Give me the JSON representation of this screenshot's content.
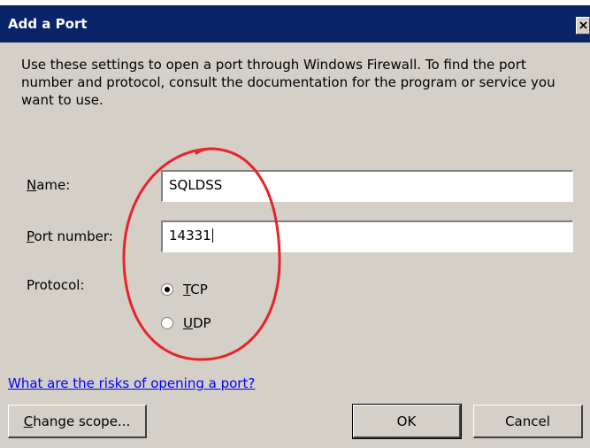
{
  "window": {
    "title": "Add a Port"
  },
  "intro_text": "Use these settings to open a port through Windows Firewall. To find the port number and protocol, consult the documentation for the program or service you want to use.",
  "fields": {
    "name": {
      "label": "Name:",
      "accesskey": "N",
      "value": "SQLDSS"
    },
    "port": {
      "label": "Port number:",
      "accesskey": "P",
      "value": "14331"
    }
  },
  "protocol": {
    "label": "Protocol:",
    "options": [
      {
        "label": "TCP",
        "accesskey": "T",
        "selected": true
      },
      {
        "label": "UDP",
        "accesskey": "U",
        "selected": false
      }
    ]
  },
  "help_link": "What are the risks of opening a port?",
  "buttons": {
    "change_scope": "Change scope...",
    "ok": "OK",
    "cancel": "Cancel"
  },
  "annotation": {
    "color": "#e8232a",
    "shape": "hand-drawn ellipse around Name, Port number and Protocol controls"
  }
}
